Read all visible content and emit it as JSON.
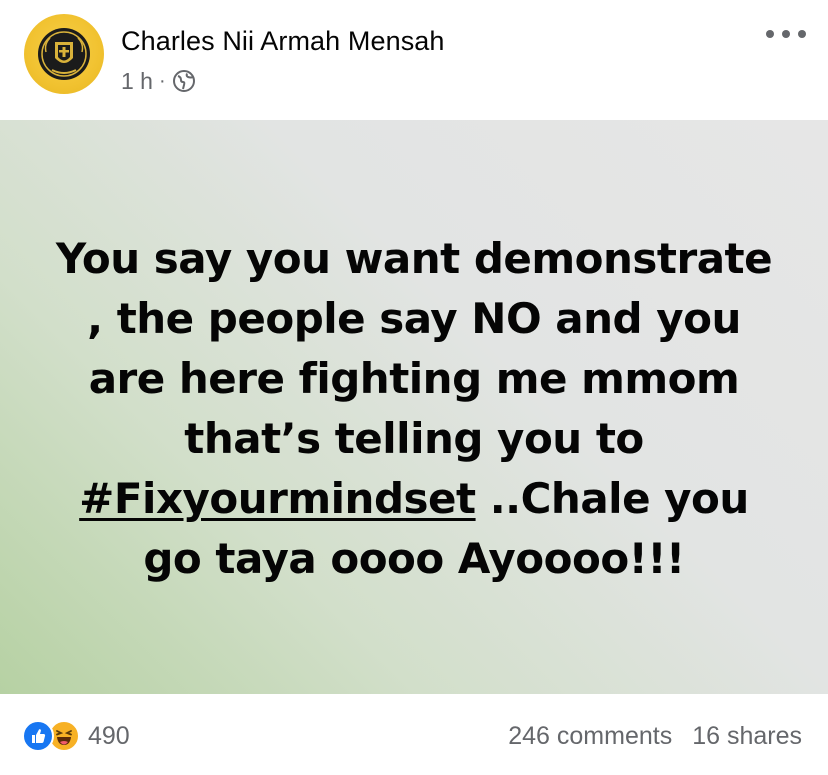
{
  "post": {
    "author": "Charles Nii Armah Mensah",
    "time": "1 h",
    "separator": "·",
    "audience_icon": "globe-icon",
    "more_icon": "more-horizontal-icon",
    "text_before_hashtag": "You say you want demonstrate , the people say NO and you are here fighting me mmom that’s telling you to ",
    "hashtag": "#Fixyourmindset",
    "text_after_hashtag": " ..Chale you go taya oooo Ayoooo!!!",
    "background_gradient": [
      "#b6d1a3",
      "#e6e6e6"
    ]
  },
  "footer": {
    "reaction_icons": [
      "like-icon",
      "haha-icon"
    ],
    "reaction_count": "490",
    "comments": "246 comments",
    "shares": "16 shares"
  },
  "colors": {
    "like_blue": "#1877f2",
    "haha_yellow": "#f7b125",
    "secondary_text": "#65676b",
    "primary_text": "#050505",
    "avatar_gold": "#f1c230"
  }
}
